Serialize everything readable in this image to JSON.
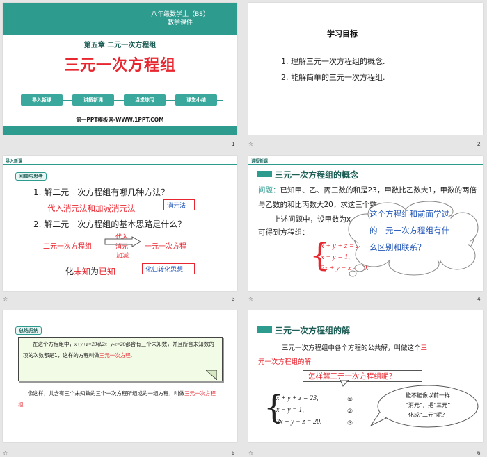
{
  "slide1": {
    "subject": "八年级数学上（BS）",
    "course": "教学课件",
    "chapter": "第五章  二元一次方程组",
    "title": "三元一次方程组",
    "nav": [
      "导入新课",
      "讲授新课",
      "当堂练习",
      "课堂小结"
    ],
    "site": "第一PPT模板网-WWW.1PPT.COM",
    "num": "1"
  },
  "slide2": {
    "heading": "学习目标",
    "goal1": "1. 理解三元一次方程组的概念.",
    "goal2": "2. 能解简单的三元一次方程组.",
    "num": "2"
  },
  "slide3": {
    "tag": "导入新课",
    "label": "回顾与思考",
    "q1": "1. 解二元一次方程组有哪几种方法？",
    "a1": "代入消元法和加减消元法",
    "a1box": "消元法",
    "q2": "2. 解二元一次方程组的基本思路是什么？",
    "from": "二元一次方程组",
    "arrow_top": "代入",
    "arrow_mid": "消元",
    "arrow_bot": "加减",
    "to": "一元一次方程",
    "ideaA": "化",
    "ideaB": "未知",
    "ideaC": "为",
    "ideaD": "已知",
    "ideabox": "化归转化思想",
    "num": "3"
  },
  "slide4": {
    "tag": "讲授新课",
    "heading": "三元一次方程组的概念",
    "q_label": "问题：",
    "q_text": "已知甲、乙、丙三数的和是23，甲数比乙数大1，甲数的两倍与乙数的和比丙数大20，求这三个数.",
    "setup": "上述问题中，设甲数为x，乙",
    "setup2": "可得到方程组：",
    "eq1": "x + y + z = 23,",
    "eq2": "x − y = 1,",
    "eq3": "2x + y − z = 20.",
    "cloud": "这个方程组和前面学过的二元一次方程组有什么区别和联系？",
    "num": "4"
  },
  "slide5": {
    "tag": "总结归纳",
    "p1a": "在这个方程组中，",
    "p1eq": "x+y+z=23和2x+y-z=20",
    "p1b": "都含有三个未知数，并且所含未知数的项的次数都是1，这样的方程叫做",
    "p1c": "三元一次方程",
    "p1d": ".",
    "p2a": "像这样，共含有三个未知数的三个一次方程所组成的一组方程，叫做",
    "p2b": "三元一次方程组",
    "p2c": ".",
    "num": "5"
  },
  "slide6": {
    "heading": "三元一次方程组的解",
    "text1": "三元一次方程组中各个方程的公共解，叫做这个",
    "text1red": "三",
    "text2red": "元一次方程组的解",
    "text2": ".",
    "question": "怎样解三元一次方程组呢？",
    "eq1": "x + y + z = 23,",
    "eq2": "x − y = 1,",
    "eq3": "2x + y − z = 20.",
    "n1": "①",
    "n2": "②",
    "n3": "③",
    "cloud1": "能不能像以前一样",
    "cloud2": "“消元”，把“三元”",
    "cloud3": "化成“二元”呢？",
    "num": "6"
  },
  "colors": {
    "teal": "#2e9b8f",
    "red": "#e8262f",
    "blue": "#2457b8"
  }
}
